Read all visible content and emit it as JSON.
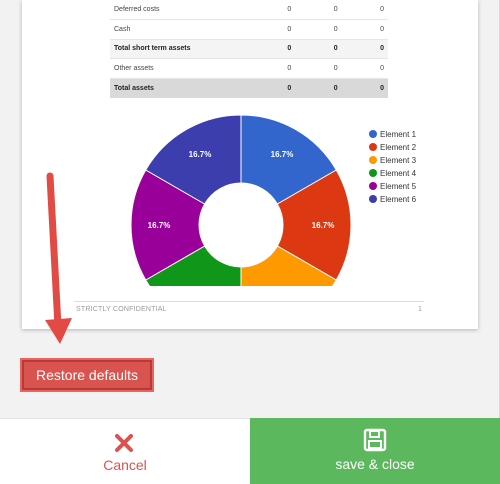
{
  "report": {
    "rows": [
      {
        "label": "Deferred costs",
        "v1": "0",
        "v2": "0",
        "v3": "0",
        "style": "normal"
      },
      {
        "label": "Cash",
        "v1": "0",
        "v2": "0",
        "v3": "0",
        "style": "normal"
      },
      {
        "label": "Total short term assets",
        "v1": "0",
        "v2": "0",
        "v3": "0",
        "style": "total"
      },
      {
        "label": "Other assets",
        "v1": "0",
        "v2": "0",
        "v3": "0",
        "style": "normal"
      },
      {
        "label": "Total assets",
        "v1": "0",
        "v2": "0",
        "v3": "0",
        "style": "grand"
      }
    ],
    "footer_text": "STRICTLY CONFIDENTIAL",
    "page_number": "1"
  },
  "chart_data": {
    "type": "pie",
    "variant": "donut",
    "visible_portion": "upper, bottom cropped",
    "labels": [
      "Element 1",
      "Element 2",
      "Element 3",
      "Element 4",
      "Element 5",
      "Element 6"
    ],
    "values": [
      16.7,
      16.7,
      16.7,
      16.7,
      16.7,
      16.7
    ],
    "data_labels": [
      "16.7%",
      "16.7%",
      "",
      "",
      "16.7%",
      "16.7%"
    ],
    "colors": [
      "#3366cc",
      "#dc3912",
      "#ff9900",
      "#109618",
      "#990099",
      "#3b3eac"
    ],
    "legend_position": "right"
  },
  "restore_label": "Restore defaults",
  "cancel_label": "Cancel",
  "save_label": "save & close",
  "colors": {
    "danger": "#d9534f",
    "success": "#5cb85c"
  },
  "icons": {
    "cancel": "close-icon",
    "save": "floppy-disk-icon",
    "annotation": "red-arrow"
  }
}
